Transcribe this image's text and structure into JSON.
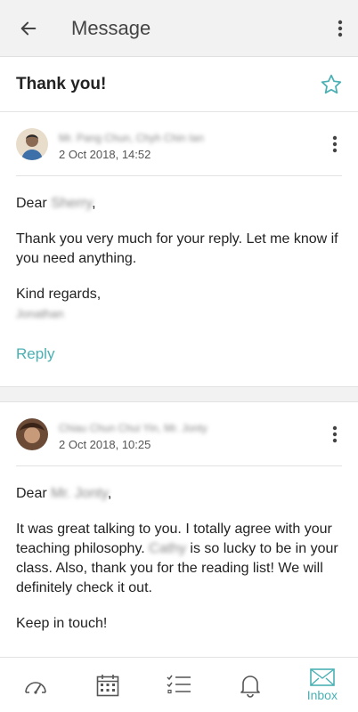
{
  "header": {
    "title": "Message"
  },
  "thread": {
    "subject": "Thank you!"
  },
  "messages": [
    {
      "sender": "Mr. Pang Chun, Chyh Chin Ian",
      "date": "2 Oct 2018, 14:52",
      "greeting": "Dear",
      "recipient": "Sherry",
      "body1": "Thank you very much for your reply. Let me know if you need anything.",
      "closing": "Kind regards,",
      "signature": "Jonathan",
      "reply_label": "Reply"
    },
    {
      "sender": "Chiau Chun Chui Yin, Mr. Jonty",
      "date": "2 Oct 2018, 10:25",
      "greeting": "Dear",
      "recipient": "Mr. Jonty",
      "body_pre": "It was great talking to you. I totally agree with your teaching philosophy.",
      "child": "Cathy",
      "body_post": "is so lucky to be in your class. Also, thank you for the reading list! We will definitely check it out.",
      "closing": "Keep in touch!"
    }
  ],
  "nav": {
    "inbox_label": "Inbox"
  },
  "colors": {
    "accent": "#4ab0b3"
  }
}
